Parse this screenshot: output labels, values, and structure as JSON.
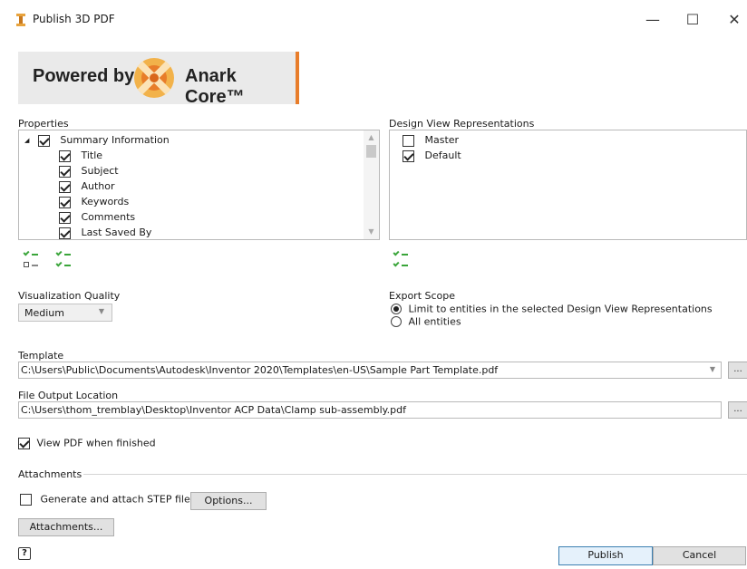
{
  "window": {
    "title": "Publish 3D PDF",
    "controls": {
      "minimize": "—",
      "maximize": "☐",
      "close": "✕"
    }
  },
  "banner": {
    "powered": "Powered by",
    "anark": "Anark Core™",
    "accent": "#e87d2a"
  },
  "properties": {
    "label": "Properties",
    "root": {
      "label": "Summary Information",
      "checked": true,
      "expander": "◢"
    },
    "items": [
      {
        "label": "Title",
        "checked": true
      },
      {
        "label": "Subject",
        "checked": true
      },
      {
        "label": "Author",
        "checked": true
      },
      {
        "label": "Keywords",
        "checked": true
      },
      {
        "label": "Comments",
        "checked": true
      },
      {
        "label": "Last Saved By",
        "checked": true
      }
    ]
  },
  "design_views": {
    "label": "Design View Representations",
    "items": [
      {
        "label": "Master",
        "checked": false
      },
      {
        "label": "Default",
        "checked": true
      }
    ]
  },
  "visualization": {
    "label": "Visualization Quality",
    "value": "Medium"
  },
  "export_scope": {
    "label": "Export Scope",
    "options": [
      {
        "label": "Limit to entities in the selected Design View Representations",
        "selected": true
      },
      {
        "label": "All entities",
        "selected": false
      }
    ]
  },
  "template": {
    "label": "Template",
    "value": "C:\\Users\\Public\\Documents\\Autodesk\\Inventor 2020\\Templates\\en-US\\Sample Part Template.pdf",
    "browse": "..."
  },
  "output": {
    "label": "File Output Location",
    "value": "C:\\Users\\thom_tremblay\\Desktop\\Inventor ACP Data\\Clamp sub-assembly.pdf",
    "browse": "..."
  },
  "view_pdf": {
    "label": "View PDF when finished",
    "checked": true
  },
  "attachments": {
    "section_label": "Attachments",
    "step_label": "Generate and attach STEP file",
    "step_checked": false,
    "options_button": "Options...",
    "attachments_button": "Attachments..."
  },
  "footer": {
    "help": "?",
    "publish": "Publish",
    "cancel": "Cancel"
  }
}
